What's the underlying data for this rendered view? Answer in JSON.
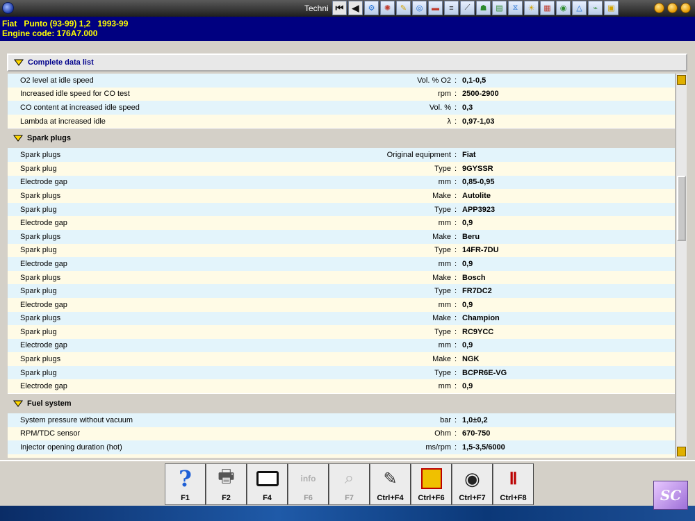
{
  "window": {
    "title": "Techni"
  },
  "vehicle": {
    "line1": "Fiat   Punto (93-99) 1,2   1993-99",
    "line2": "Engine code: 176A7.000"
  },
  "header_section": {
    "label": "Complete data list"
  },
  "rows_top": [
    {
      "param": "O2 level at idle speed",
      "unit": "Vol. % O2",
      "value": "0,1-0,5"
    },
    {
      "param": "Increased idle speed for CO test",
      "unit": "rpm",
      "value": "2500-2900"
    },
    {
      "param": "CO content at increased idle speed",
      "unit": "Vol. %",
      "value": "0,3"
    },
    {
      "param": "Lambda at increased idle",
      "unit": "λ",
      "value": "0,97-1,03"
    }
  ],
  "spark_section": {
    "label": "Spark plugs"
  },
  "rows_spark": [
    {
      "param": "Spark plugs",
      "unit": "Original equipment",
      "value": "Fiat"
    },
    {
      "param": "Spark plug",
      "unit": "Type",
      "value": "9GYSSR"
    },
    {
      "param": "Electrode gap",
      "unit": "mm",
      "value": "0,85-0,95"
    },
    {
      "param": "Spark plugs",
      "unit": "Make",
      "value": "Autolite"
    },
    {
      "param": "Spark plug",
      "unit": "Type",
      "value": "APP3923"
    },
    {
      "param": "Electrode gap",
      "unit": "mm",
      "value": "0,9"
    },
    {
      "param": "Spark plugs",
      "unit": "Make",
      "value": "Beru"
    },
    {
      "param": "Spark plug",
      "unit": "Type",
      "value": "14FR-7DU"
    },
    {
      "param": "Electrode gap",
      "unit": "mm",
      "value": "0,9"
    },
    {
      "param": "Spark plugs",
      "unit": "Make",
      "value": "Bosch"
    },
    {
      "param": "Spark plug",
      "unit": "Type",
      "value": "FR7DC2"
    },
    {
      "param": "Electrode gap",
      "unit": "mm",
      "value": "0,9"
    },
    {
      "param": "Spark plugs",
      "unit": "Make",
      "value": "Champion"
    },
    {
      "param": "Spark plug",
      "unit": "Type",
      "value": "RC9YCC"
    },
    {
      "param": "Electrode gap",
      "unit": "mm",
      "value": "0,9"
    },
    {
      "param": "Spark plugs",
      "unit": "Make",
      "value": "NGK"
    },
    {
      "param": "Spark plug",
      "unit": "Type",
      "value": "BCPR6E-VG"
    },
    {
      "param": "Electrode gap",
      "unit": "mm",
      "value": "0,9"
    }
  ],
  "fuel_section": {
    "label": "Fuel system"
  },
  "rows_fuel": [
    {
      "param": "System pressure without vacuum",
      "unit": "bar",
      "value": "1,0±0,2"
    },
    {
      "param": "RPM/TDC sensor",
      "unit": "Ohm",
      "value": "670-750"
    },
    {
      "param": "Injector opening duration (hot)",
      "unit": "ms/rpm",
      "value": "1,5-3,5/6000"
    }
  ],
  "fkeys": [
    {
      "label": "F1",
      "icon": "help-icon",
      "enabled": true
    },
    {
      "label": "F2",
      "icon": "printer-icon",
      "enabled": true
    },
    {
      "label": "F4",
      "icon": "window-icon",
      "enabled": true
    },
    {
      "label": "F6",
      "icon": "info-graphic-icon",
      "enabled": false
    },
    {
      "label": "F7",
      "icon": "zoom-icon",
      "enabled": false
    },
    {
      "label": "Ctrl+F4",
      "icon": "notes-icon",
      "enabled": true
    },
    {
      "label": "Ctrl+F6",
      "icon": "settings-card-icon",
      "enabled": true
    },
    {
      "label": "Ctrl+F7",
      "icon": "tire-gauge-icon",
      "enabled": true
    },
    {
      "label": "Ctrl+F8",
      "icon": "lift-icon",
      "enabled": true
    }
  ],
  "logo": {
    "text": "SC"
  },
  "colors": {
    "header_bg": "#000080",
    "header_text": "#ffff00",
    "row_blue": "#e3f4fb",
    "row_cream": "#fffbe6",
    "accent": "#e0b000"
  }
}
